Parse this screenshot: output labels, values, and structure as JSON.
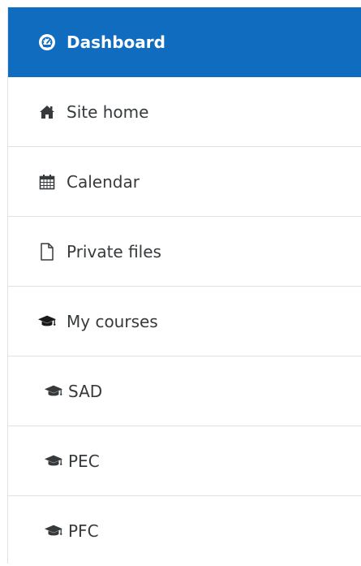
{
  "nav": {
    "items": [
      {
        "label": "Dashboard",
        "icon": "dashboard-icon"
      },
      {
        "label": "Site home",
        "icon": "home-icon"
      },
      {
        "label": "Calendar",
        "icon": "calendar-icon"
      },
      {
        "label": "Private files",
        "icon": "file-icon"
      },
      {
        "label": "My courses",
        "icon": "graduation-cap-icon"
      },
      {
        "label": "SAD",
        "icon": "graduation-cap-icon"
      },
      {
        "label": "PEC",
        "icon": "graduation-cap-icon"
      },
      {
        "label": "PFC",
        "icon": "graduation-cap-icon"
      }
    ]
  },
  "colors": {
    "active_bg": "#0f6cbf",
    "active_text": "#ffffff",
    "text": "#373a3c",
    "divider": "#dee2e6"
  }
}
